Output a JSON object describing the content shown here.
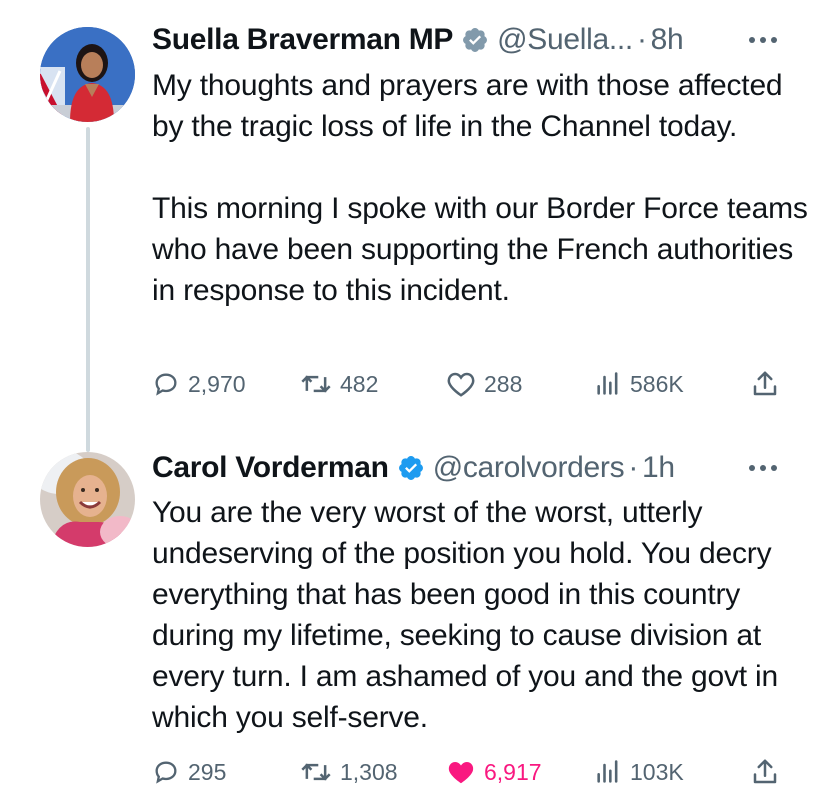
{
  "tweets": [
    {
      "author": {
        "name": "Suella Braverman MP",
        "handle": "@Suella...",
        "verified_color": "#829aab"
      },
      "separator": "·",
      "time": "8h",
      "text": "My thoughts and prayers are with those affected by the tragic loss of life in the Channel today.\n\nThis morning I spoke with our Border Force teams who have been supporting the French authorities in response to this incident.",
      "stats": {
        "replies": "2,970",
        "reposts": "482",
        "likes": "288",
        "views": "586K"
      },
      "liked": false
    },
    {
      "author": {
        "name": "Carol Vorderman",
        "handle": "@carolvorders",
        "verified_color": "#1d9bf0"
      },
      "separator": "·",
      "time": "1h",
      "text": "You are the very worst of the worst, utterly undeserving of the position you hold.  You decry everything that has been good in this country during my lifetime, seeking to cause division at every turn.  I am ashamed of you and the govt in which you self-serve.",
      "stats": {
        "replies": "295",
        "reposts": "1,308",
        "likes": "6,917",
        "views": "103K"
      },
      "liked": true
    }
  ],
  "icons": {
    "verified": "verified-badge-icon",
    "more": "more-options-icon",
    "reply": "reply-icon",
    "repost": "repost-icon",
    "like": "heart-icon",
    "views": "views-icon",
    "share": "share-icon"
  },
  "colors": {
    "muted": "#536471",
    "like_active": "#f91880",
    "thread_line": "#cfd9de"
  }
}
